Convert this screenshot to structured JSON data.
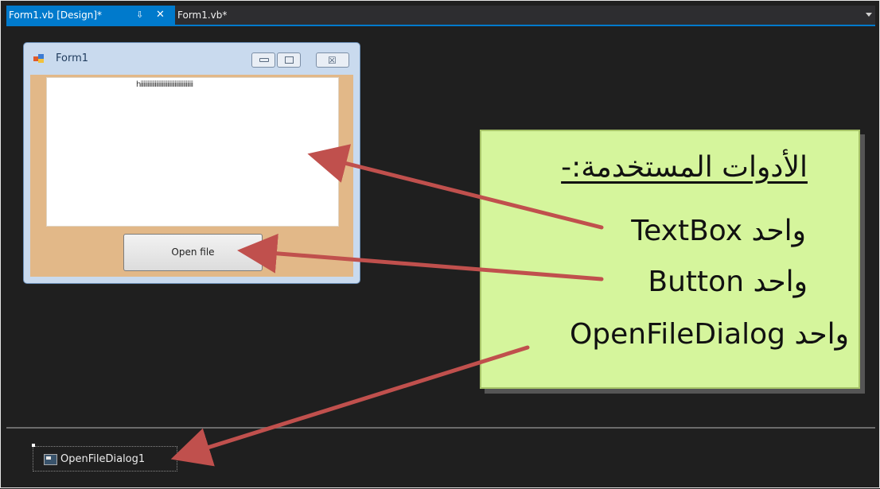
{
  "tabs": [
    {
      "label": "Form1.vb [Design]*",
      "pin": "⇩",
      "close": "✕"
    },
    {
      "label": "Form1.vb*"
    }
  ],
  "form": {
    "title": "Form1",
    "textbox_value": "hiiiiiiiiiiiiiiiiiiiiiiiiiiiiiiiiiiiii",
    "button_label": "Open file"
  },
  "tray": {
    "component_label": "OpenFileDialog1"
  },
  "callout": {
    "title": "الأدوات المستخدمة:-",
    "items": [
      "واحد TextBox",
      "واحد Button",
      "واحد OpenFileDialog"
    ]
  },
  "colors": {
    "accent": "#007acc",
    "callout_bg": "#d5f59c",
    "arrow": "#c0504d",
    "form_client": "#e2b888"
  }
}
